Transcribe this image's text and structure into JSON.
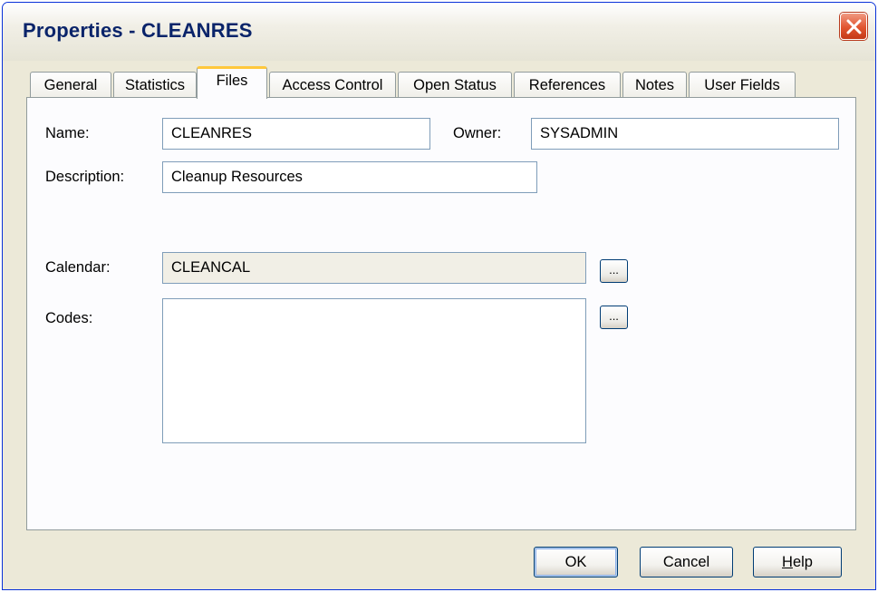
{
  "window": {
    "title": "Properties - CLEANRES"
  },
  "tabs": [
    {
      "label": "General",
      "active": false
    },
    {
      "label": "Statistics",
      "active": false
    },
    {
      "label": "Files",
      "active": true
    },
    {
      "label": "Access Control",
      "active": false
    },
    {
      "label": "Open Status",
      "active": false
    },
    {
      "label": "References",
      "active": false
    },
    {
      "label": "Notes",
      "active": false
    },
    {
      "label": "User Fields",
      "active": false
    }
  ],
  "form": {
    "name_label": "Name:",
    "name_value": "CLEANRES",
    "owner_label": "Owner:",
    "owner_value": "SYSADMIN",
    "description_label": "Description:",
    "description_value": "Cleanup Resources",
    "calendar_label": "Calendar:",
    "calendar_value": "CLEANCAL",
    "codes_label": "Codes:",
    "codes_value": "",
    "browse_label": "..."
  },
  "buttons": {
    "ok": "OK",
    "cancel": "Cancel",
    "help_mnemonic": "H",
    "help_rest": "elp"
  },
  "icons": {
    "close": "close-icon"
  },
  "colors": {
    "window_bg": "#ece9d8",
    "title_text": "#0a246a",
    "active_tab_accent": "#ffc83c",
    "close_button": "#e1542f",
    "field_border": "#7f9db9"
  }
}
